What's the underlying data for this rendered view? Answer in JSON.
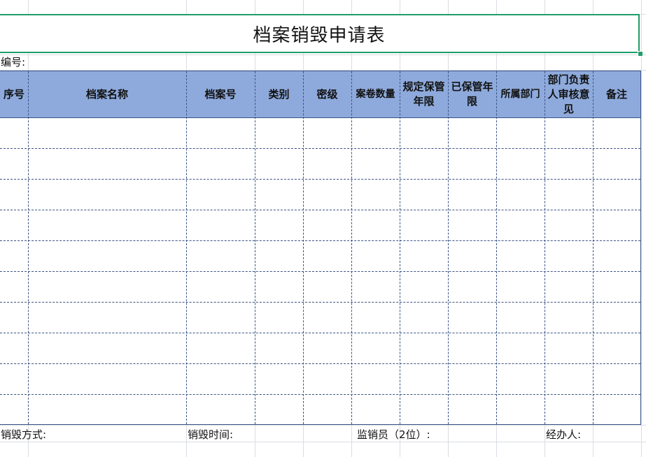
{
  "title": "档案销毁申请表",
  "number_label": "编号:",
  "headers": [
    "序号",
    "档案名称",
    "档案号",
    "类别",
    "密级",
    "案卷数量",
    "规定保管年限",
    "已保管年限",
    "所属部门",
    "部门负责人审核意见",
    "备注"
  ],
  "empty_rows": 10,
  "footer": {
    "method_label": "销毁方式:",
    "time_label": "销毁时间:",
    "supervisor_label": "监销员（2位）:",
    "handler_label": "经办人:"
  },
  "colors": {
    "header_fill": "#8eaadc",
    "border": "#3b5485",
    "selection": "#1e9e6a"
  }
}
